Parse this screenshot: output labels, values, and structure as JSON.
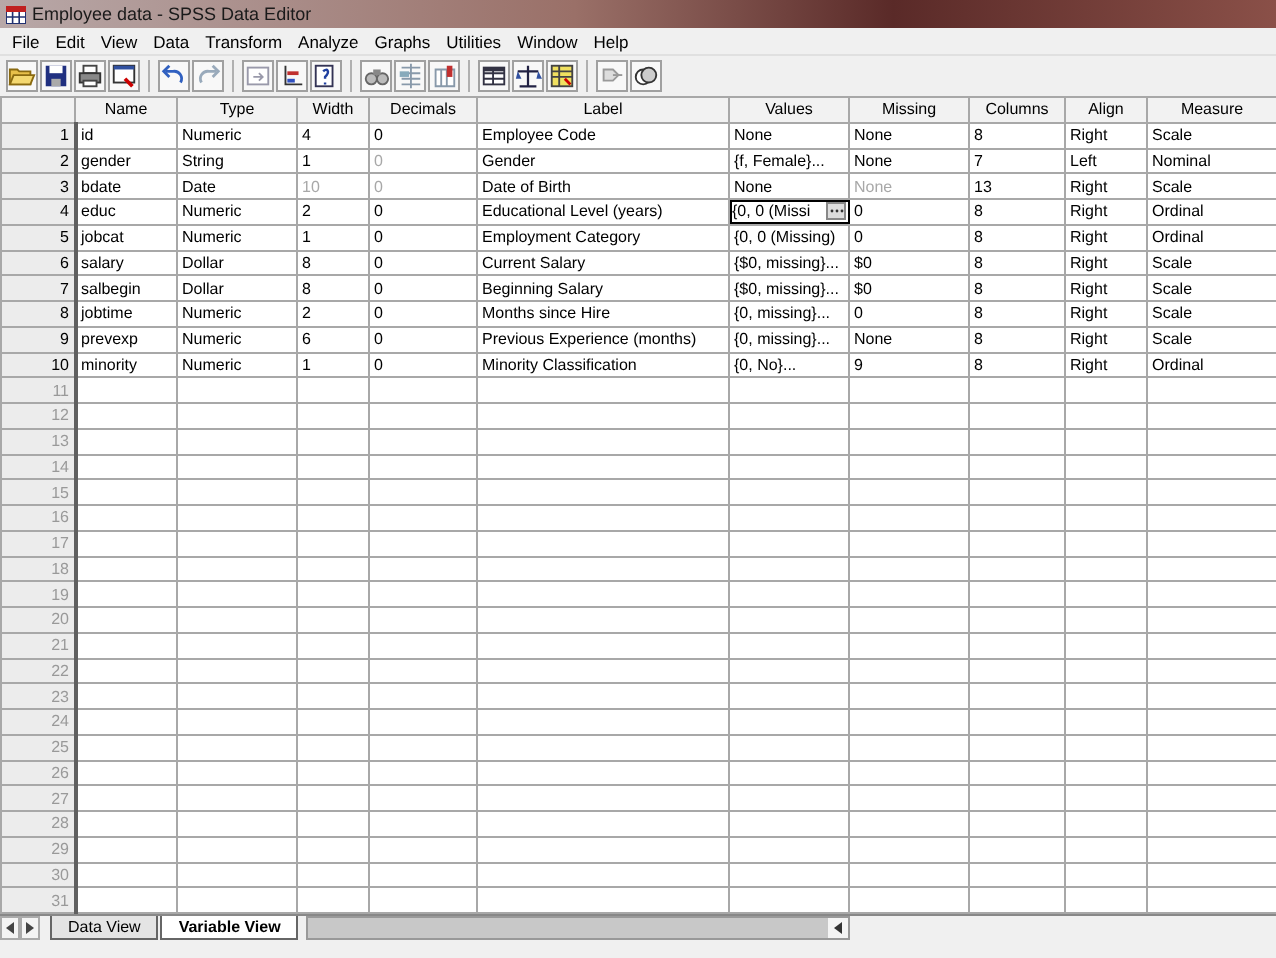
{
  "window": {
    "title": "Employee data - SPSS Data Editor"
  },
  "menu": [
    "File",
    "Edit",
    "View",
    "Data",
    "Transform",
    "Analyze",
    "Graphs",
    "Utilities",
    "Window",
    "Help"
  ],
  "table": {
    "columns": [
      "Name",
      "Type",
      "Width",
      "Decimals",
      "Label",
      "Values",
      "Missing",
      "Columns",
      "Align",
      "Measure"
    ],
    "rows": [
      {
        "number": "1",
        "cells": [
          {
            "text": "id",
            "disabled": false,
            "editing": false
          },
          {
            "text": "Numeric",
            "disabled": false,
            "editing": false
          },
          {
            "text": "4",
            "disabled": false,
            "editing": false
          },
          {
            "text": "0",
            "disabled": false,
            "editing": false
          },
          {
            "text": "Employee Code",
            "disabled": false,
            "editing": false
          },
          {
            "text": "None",
            "disabled": false,
            "editing": false
          },
          {
            "text": "None",
            "disabled": false,
            "editing": false
          },
          {
            "text": "8",
            "disabled": false,
            "editing": false
          },
          {
            "text": "Right",
            "disabled": false,
            "editing": false
          },
          {
            "text": "Scale",
            "disabled": false,
            "editing": false
          }
        ]
      },
      {
        "number": "2",
        "cells": [
          {
            "text": "gender",
            "disabled": false,
            "editing": false
          },
          {
            "text": "String",
            "disabled": false,
            "editing": false
          },
          {
            "text": "1",
            "disabled": false,
            "editing": false
          },
          {
            "text": "0",
            "disabled": true,
            "editing": false
          },
          {
            "text": "Gender",
            "disabled": false,
            "editing": false
          },
          {
            "text": "{f, Female}...",
            "disabled": false,
            "editing": false
          },
          {
            "text": "None",
            "disabled": false,
            "editing": false
          },
          {
            "text": "7",
            "disabled": false,
            "editing": false
          },
          {
            "text": "Left",
            "disabled": false,
            "editing": false
          },
          {
            "text": "Nominal",
            "disabled": false,
            "editing": false
          }
        ]
      },
      {
        "number": "3",
        "cells": [
          {
            "text": "bdate",
            "disabled": false,
            "editing": false
          },
          {
            "text": "Date",
            "disabled": false,
            "editing": false
          },
          {
            "text": "10",
            "disabled": true,
            "editing": false
          },
          {
            "text": "0",
            "disabled": true,
            "editing": false
          },
          {
            "text": "Date of Birth",
            "disabled": false,
            "editing": false
          },
          {
            "text": "None",
            "disabled": false,
            "editing": false
          },
          {
            "text": "None",
            "disabled": true,
            "editing": false
          },
          {
            "text": "13",
            "disabled": false,
            "editing": false
          },
          {
            "text": "Right",
            "disabled": false,
            "editing": false
          },
          {
            "text": "Scale",
            "disabled": false,
            "editing": false
          }
        ]
      },
      {
        "number": "4",
        "cells": [
          {
            "text": "educ",
            "disabled": false,
            "editing": false
          },
          {
            "text": "Numeric",
            "disabled": false,
            "editing": false
          },
          {
            "text": "2",
            "disabled": false,
            "editing": false
          },
          {
            "text": "0",
            "disabled": false,
            "editing": false
          },
          {
            "text": "Educational Level (years)",
            "disabled": false,
            "editing": false
          },
          {
            "text": "{0, 0 (Missi",
            "disabled": false,
            "editing": true
          },
          {
            "text": "0",
            "disabled": false,
            "editing": false
          },
          {
            "text": "8",
            "disabled": false,
            "editing": false
          },
          {
            "text": "Right",
            "disabled": false,
            "editing": false
          },
          {
            "text": "Ordinal",
            "disabled": false,
            "editing": false
          }
        ]
      },
      {
        "number": "5",
        "cells": [
          {
            "text": "jobcat",
            "disabled": false,
            "editing": false
          },
          {
            "text": "Numeric",
            "disabled": false,
            "editing": false
          },
          {
            "text": "1",
            "disabled": false,
            "editing": false
          },
          {
            "text": "0",
            "disabled": false,
            "editing": false
          },
          {
            "text": "Employment Category",
            "disabled": false,
            "editing": false
          },
          {
            "text": "{0, 0 (Missing)",
            "disabled": false,
            "editing": false
          },
          {
            "text": "0",
            "disabled": false,
            "editing": false
          },
          {
            "text": "8",
            "disabled": false,
            "editing": false
          },
          {
            "text": "Right",
            "disabled": false,
            "editing": false
          },
          {
            "text": "Ordinal",
            "disabled": false,
            "editing": false
          }
        ]
      },
      {
        "number": "6",
        "cells": [
          {
            "text": "salary",
            "disabled": false,
            "editing": false
          },
          {
            "text": "Dollar",
            "disabled": false,
            "editing": false
          },
          {
            "text": "8",
            "disabled": false,
            "editing": false
          },
          {
            "text": "0",
            "disabled": false,
            "editing": false
          },
          {
            "text": "Current Salary",
            "disabled": false,
            "editing": false
          },
          {
            "text": "{$0, missing}...",
            "disabled": false,
            "editing": false
          },
          {
            "text": "$0",
            "disabled": false,
            "editing": false
          },
          {
            "text": "8",
            "disabled": false,
            "editing": false
          },
          {
            "text": "Right",
            "disabled": false,
            "editing": false
          },
          {
            "text": "Scale",
            "disabled": false,
            "editing": false
          }
        ]
      },
      {
        "number": "7",
        "cells": [
          {
            "text": "salbegin",
            "disabled": false,
            "editing": false
          },
          {
            "text": "Dollar",
            "disabled": false,
            "editing": false
          },
          {
            "text": "8",
            "disabled": false,
            "editing": false
          },
          {
            "text": "0",
            "disabled": false,
            "editing": false
          },
          {
            "text": "Beginning Salary",
            "disabled": false,
            "editing": false
          },
          {
            "text": "{$0, missing}...",
            "disabled": false,
            "editing": false
          },
          {
            "text": "$0",
            "disabled": false,
            "editing": false
          },
          {
            "text": "8",
            "disabled": false,
            "editing": false
          },
          {
            "text": "Right",
            "disabled": false,
            "editing": false
          },
          {
            "text": "Scale",
            "disabled": false,
            "editing": false
          }
        ]
      },
      {
        "number": "8",
        "cells": [
          {
            "text": "jobtime",
            "disabled": false,
            "editing": false
          },
          {
            "text": "Numeric",
            "disabled": false,
            "editing": false
          },
          {
            "text": "2",
            "disabled": false,
            "editing": false
          },
          {
            "text": "0",
            "disabled": false,
            "editing": false
          },
          {
            "text": "Months since Hire",
            "disabled": false,
            "editing": false
          },
          {
            "text": "{0, missing}...",
            "disabled": false,
            "editing": false
          },
          {
            "text": "0",
            "disabled": false,
            "editing": false
          },
          {
            "text": "8",
            "disabled": false,
            "editing": false
          },
          {
            "text": "Right",
            "disabled": false,
            "editing": false
          },
          {
            "text": "Scale",
            "disabled": false,
            "editing": false
          }
        ]
      },
      {
        "number": "9",
        "cells": [
          {
            "text": "prevexp",
            "disabled": false,
            "editing": false
          },
          {
            "text": "Numeric",
            "disabled": false,
            "editing": false
          },
          {
            "text": "6",
            "disabled": false,
            "editing": false
          },
          {
            "text": "0",
            "disabled": false,
            "editing": false
          },
          {
            "text": "Previous Experience (months)",
            "disabled": false,
            "editing": false
          },
          {
            "text": "{0, missing}...",
            "disabled": false,
            "editing": false
          },
          {
            "text": "None",
            "disabled": false,
            "editing": false
          },
          {
            "text": "8",
            "disabled": false,
            "editing": false
          },
          {
            "text": "Right",
            "disabled": false,
            "editing": false
          },
          {
            "text": "Scale",
            "disabled": false,
            "editing": false
          }
        ]
      },
      {
        "number": "10",
        "cells": [
          {
            "text": "minority",
            "disabled": false,
            "editing": false
          },
          {
            "text": "Numeric",
            "disabled": false,
            "editing": false
          },
          {
            "text": "1",
            "disabled": false,
            "editing": false
          },
          {
            "text": "0",
            "disabled": false,
            "editing": false
          },
          {
            "text": "Minority Classification",
            "disabled": false,
            "editing": false
          },
          {
            "text": "{0, No}...",
            "disabled": false,
            "editing": false
          },
          {
            "text": "9",
            "disabled": false,
            "editing": false
          },
          {
            "text": "8",
            "disabled": false,
            "editing": false
          },
          {
            "text": "Right",
            "disabled": false,
            "editing": false
          },
          {
            "text": "Ordinal",
            "disabled": false,
            "editing": false
          }
        ]
      }
    ],
    "empty_rows": [
      "11",
      "12",
      "13",
      "14",
      "15",
      "16",
      "17",
      "18",
      "19",
      "20",
      "21",
      "22",
      "23",
      "24",
      "25",
      "26",
      "27",
      "28",
      "29",
      "30",
      "31"
    ]
  },
  "tabs": [
    {
      "label": "Data View",
      "selected": false
    },
    {
      "label": "Variable View",
      "selected": true
    }
  ]
}
